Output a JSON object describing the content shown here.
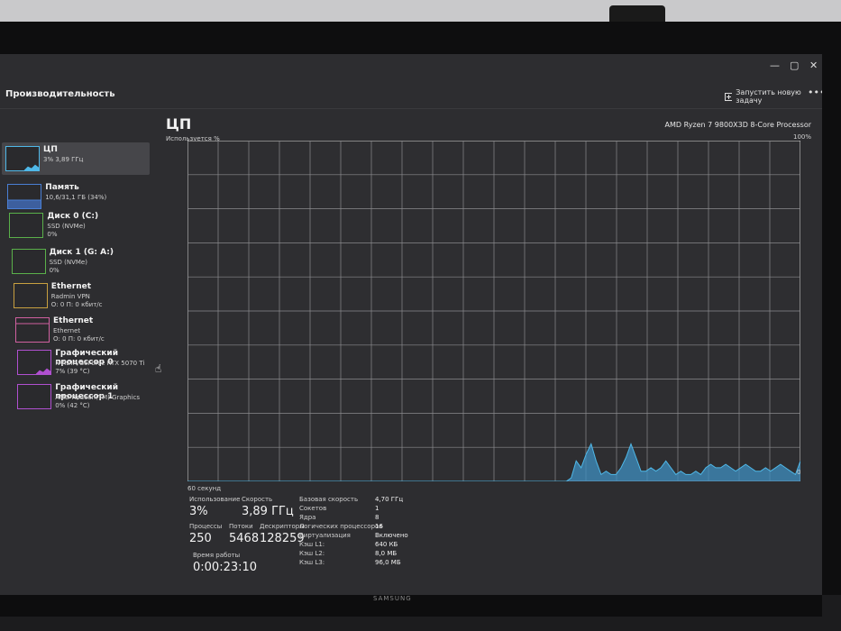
{
  "window": {
    "minimize": "—",
    "maximize": "▢",
    "close": "✕"
  },
  "header": {
    "title": "Производительность",
    "run_task": "Запустить новую задачу",
    "more": "•••"
  },
  "sidebar": {
    "items": [
      {
        "name": "ЦП",
        "line1": "3% 3,89 ГГц",
        "line2": "",
        "line3": "",
        "selected": true,
        "color": "#4fb8e8"
      },
      {
        "name": "Память",
        "line1": "10,6/31,1 ГБ (34%)",
        "line2": "",
        "line3": "",
        "selected": false,
        "color": "#4a7fd4"
      },
      {
        "name": "Диск 0 (C:)",
        "line1": "SSD (NVMe)",
        "line2": "0%",
        "line3": "",
        "selected": false,
        "color": "#5ab04a"
      },
      {
        "name": "Диск 1 (G: A:)",
        "line1": "SSD (NVMe)",
        "line2": "0%",
        "line3": "",
        "selected": false,
        "color": "#5ab04a"
      },
      {
        "name": "Ethernet",
        "line1": "Radmin VPN",
        "line2": "О: 0 П: 0 кбит/с",
        "line3": "",
        "selected": false,
        "color": "#c8a040"
      },
      {
        "name": "Ethernet",
        "line1": "Ethernet",
        "line2": "О: 0 П: 0 кбит/с",
        "line3": "",
        "selected": false,
        "color": "#d060a0"
      },
      {
        "name": "Графический процессор 0",
        "line1": "NVIDIA GeForce RTX 5070 Ti",
        "line2": "7% (39 °C)",
        "line3": "",
        "selected": false,
        "color": "#b050d0"
      },
      {
        "name": "Графический процессор 1",
        "line1": "AMD Radeon(TM) Graphics",
        "line2": "0% (42 °C)",
        "line3": "",
        "selected": false,
        "color": "#b050d0"
      }
    ]
  },
  "main": {
    "title": "ЦП",
    "cpu_name": "AMD Ryzen 7 9800X3D 8-Core Processor",
    "util_label": "Используется %",
    "max_label": "100%",
    "time_label": "60 секунд",
    "zero_label": "0",
    "graph_color": "#4fb8e8"
  },
  "chart_data": {
    "type": "area",
    "ylim": [
      0,
      100
    ],
    "grid": true,
    "values": [
      0,
      0,
      0,
      0,
      0,
      0,
      0,
      0,
      0,
      0,
      0,
      0,
      0,
      0,
      0,
      0,
      0,
      0,
      0,
      0,
      0,
      0,
      0,
      0,
      0,
      0,
      0,
      0,
      0,
      0,
      0,
      0,
      0,
      0,
      0,
      0,
      0,
      0,
      0,
      0,
      0,
      0,
      0,
      0,
      0,
      0,
      0,
      0,
      0,
      0,
      0,
      0,
      0,
      0,
      0,
      0,
      0,
      0,
      0,
      0,
      0,
      0,
      0,
      0,
      0,
      0,
      0,
      0,
      0,
      0,
      0,
      0,
      0,
      0,
      0,
      0,
      0,
      1,
      6,
      4,
      8,
      11,
      6,
      2,
      3,
      2,
      2,
      4,
      7,
      11,
      7,
      3,
      3,
      4,
      3,
      4,
      6,
      4,
      2,
      3,
      2,
      2,
      3,
      2,
      4,
      5,
      4,
      4,
      5,
      4,
      3,
      4,
      5,
      4,
      3,
      3,
      4,
      3,
      4,
      5,
      4,
      3,
      2,
      6
    ]
  },
  "stats": {
    "usage_label": "Использование",
    "usage_value": "3%",
    "speed_label": "Скорость",
    "speed_value": "3,89 ГГц",
    "proc_label": "Процессы",
    "proc_value": "250",
    "threads_label": "Потоки",
    "threads_value": "5468",
    "handles_label": "Дескрипторы",
    "handles_value": "128259",
    "uptime_label": "Время работы",
    "uptime_value": "0:00:23:10",
    "kv": [
      {
        "k": "Базовая скорость",
        "v": "4,70 ГГц"
      },
      {
        "k": "Сокетов",
        "v": "1"
      },
      {
        "k": "Ядра",
        "v": "8"
      },
      {
        "k": "Логических процессоров",
        "v": "16"
      },
      {
        "k": "Виртуализация",
        "v": "Включено"
      },
      {
        "k": "Кэш L1:",
        "v": "640 КБ"
      },
      {
        "k": "Кэш L2:",
        "v": "8,0 МБ"
      },
      {
        "k": "Кэш L3:",
        "v": "96,0 МБ"
      }
    ]
  },
  "brand": "SAMSUNG"
}
